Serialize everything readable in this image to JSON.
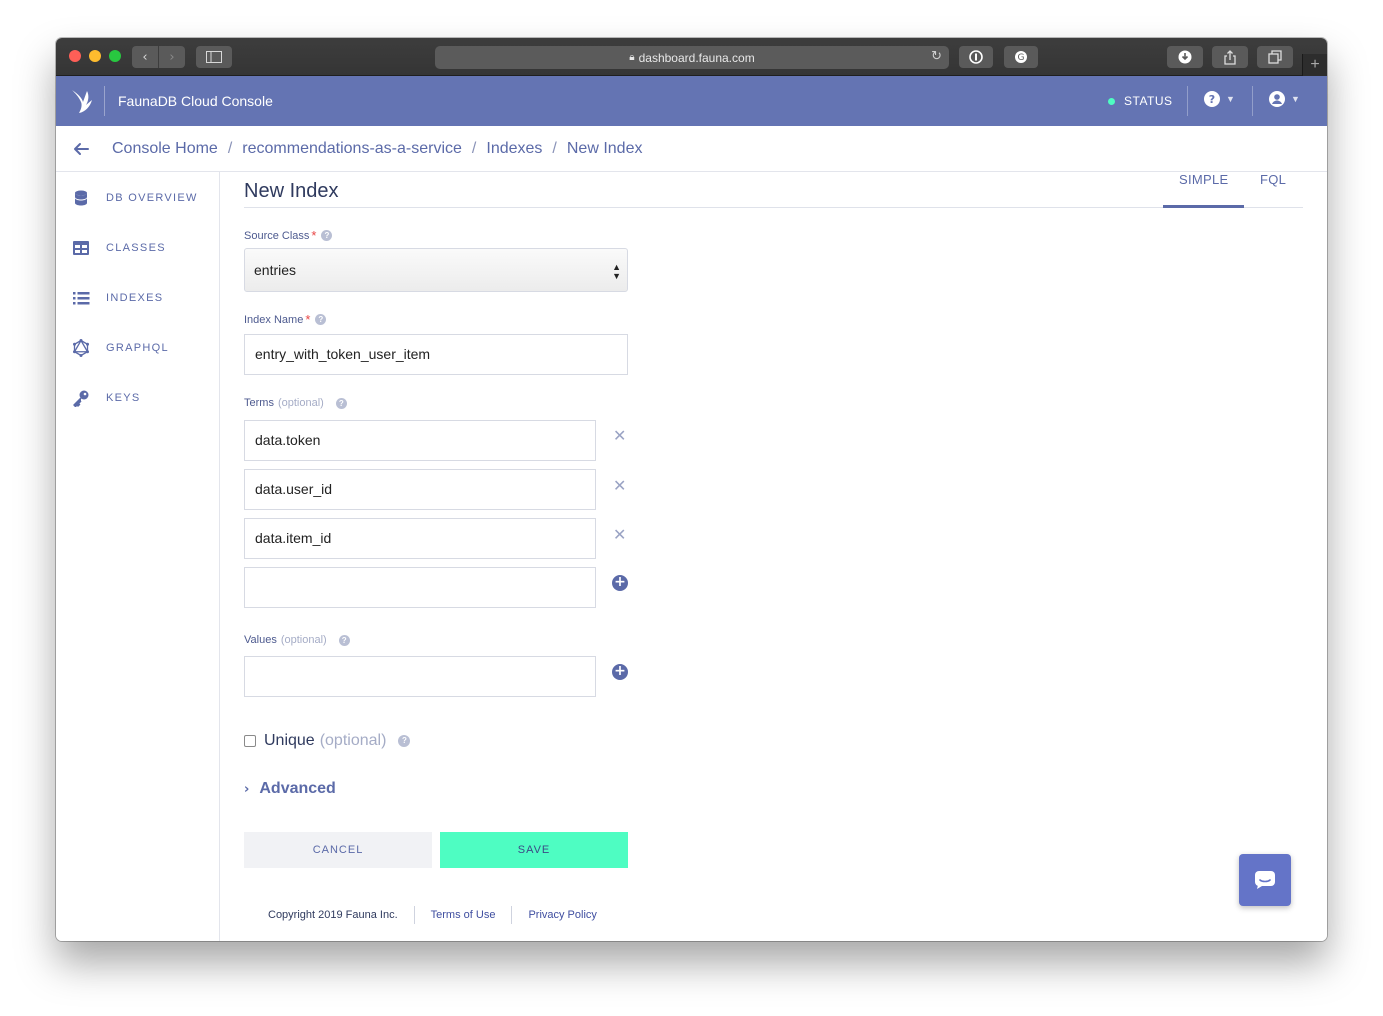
{
  "browser": {
    "url": "dashboard.fauna.com",
    "lock_icon": "lock-icon",
    "reload_icon": "reload-icon"
  },
  "app": {
    "title": "FaunaDB Cloud Console",
    "status_label": "STATUS",
    "status_color": "#4efdc2",
    "brand_color": "#6474b3",
    "accent_color": "#5b6aa8"
  },
  "breadcrumb": {
    "items": [
      "Console Home",
      "recommendations-as-a-service",
      "Indexes",
      "New Index"
    ],
    "separator": "/"
  },
  "sidebar": {
    "items": [
      {
        "label": "DB OVERVIEW",
        "icon": "database-icon"
      },
      {
        "label": "CLASSES",
        "icon": "table-icon"
      },
      {
        "label": "INDEXES",
        "icon": "list-icon"
      },
      {
        "label": "GRAPHQL",
        "icon": "graphql-icon"
      },
      {
        "label": "KEYS",
        "icon": "key-icon"
      }
    ]
  },
  "page": {
    "title": "New Index",
    "mode_tabs": [
      "SIMPLE",
      "FQL"
    ],
    "active_tab": "SIMPLE"
  },
  "form": {
    "source_class": {
      "label": "Source Class",
      "required": "*",
      "value": "entries"
    },
    "index_name": {
      "label": "Index Name",
      "required": "*",
      "value": "entry_with_token_user_item"
    },
    "terms": {
      "label": "Terms",
      "optional": "(optional)",
      "values": [
        "data.token",
        "data.user_id",
        "data.item_id",
        ""
      ]
    },
    "values": {
      "label": "Values",
      "optional": "(optional)",
      "values": [
        ""
      ]
    },
    "unique": {
      "label": "Unique",
      "optional": "(optional)",
      "checked": false
    },
    "advanced_label": "Advanced",
    "cancel_label": "CANCEL",
    "save_label": "SAVE",
    "save_color": "#4efdc2"
  },
  "footer": {
    "copyright": "Copyright 2019 Fauna Inc.",
    "terms_link": "Terms of Use",
    "privacy_link": "Privacy Policy"
  }
}
